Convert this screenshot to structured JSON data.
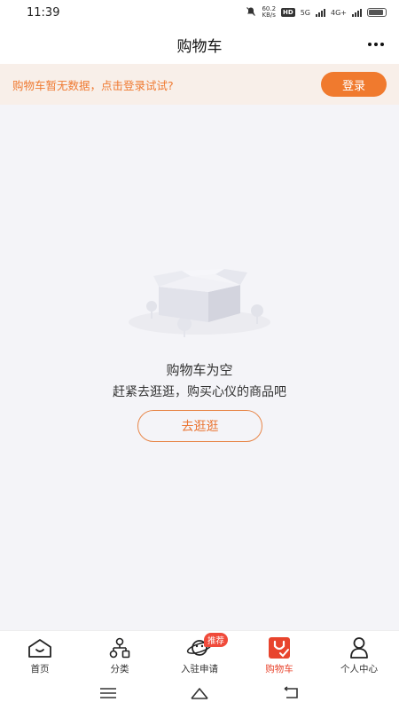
{
  "status_bar": {
    "time": "11:39",
    "net_speed_value": "60.2",
    "net_speed_unit": "KB/s",
    "hd_label": "HD",
    "signal1_label": "5G",
    "signal2_label": "4G+"
  },
  "header": {
    "title": "购物车",
    "more_icon": "more-dots-icon"
  },
  "login_banner": {
    "text": "购物车暂无数据，点击登录试试?",
    "button_label": "登录"
  },
  "empty_state": {
    "illustration": "empty-box-icon",
    "title": "购物车为空",
    "subtitle": "赶紧去逛逛，购买心仪的商品吧",
    "button_label": "去逛逛"
  },
  "bottom_nav": {
    "items": [
      {
        "label": "首页",
        "icon": "home-icon"
      },
      {
        "label": "分类",
        "icon": "category-icon"
      },
      {
        "label": "入驻申请",
        "icon": "planet-icon",
        "badge": "推荐"
      },
      {
        "label": "购物车",
        "icon": "cart-icon",
        "active": true
      },
      {
        "label": "个人中心",
        "icon": "user-icon"
      }
    ]
  },
  "system_nav": {
    "buttons": [
      "menu-icon",
      "home-icon",
      "back-icon"
    ]
  },
  "colors": {
    "accent": "#f07a2e",
    "banner_bg": "#f8efe9",
    "active_tab": "#e8442d",
    "page_bg": "#f4f4f8"
  }
}
